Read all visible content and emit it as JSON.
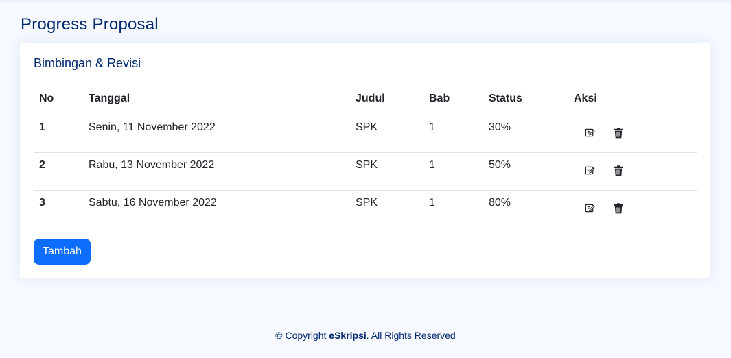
{
  "page": {
    "title": "Progress Proposal"
  },
  "card": {
    "title": "Bimbingan & Revisi"
  },
  "table": {
    "headers": {
      "no": "No",
      "tanggal": "Tanggal",
      "judul": "Judul",
      "bab": "Bab",
      "status": "Status",
      "aksi": "Aksi"
    },
    "rows": [
      {
        "no": "1",
        "tanggal": "Senin, 11 November 2022",
        "judul": "SPK",
        "bab": "1",
        "status": "30%"
      },
      {
        "no": "2",
        "tanggal": "Rabu, 13 November 2022",
        "judul": "SPK",
        "bab": "1",
        "status": "50%"
      },
      {
        "no": "3",
        "tanggal": "Sabtu, 16 November 2022",
        "judul": "SPK",
        "bab": "1",
        "status": "80%"
      }
    ],
    "row_actions": {
      "edit_icon": "edit-icon",
      "delete_icon": "trash-icon"
    }
  },
  "actions": {
    "add_label": "Tambah"
  },
  "footer": {
    "prefix": "© Copyright ",
    "brand": "eSkripsi",
    "suffix": ". All Rights Reserved"
  },
  "colors": {
    "primary": "#0d6efd",
    "heading": "#012970",
    "background": "#f6f9ff"
  }
}
